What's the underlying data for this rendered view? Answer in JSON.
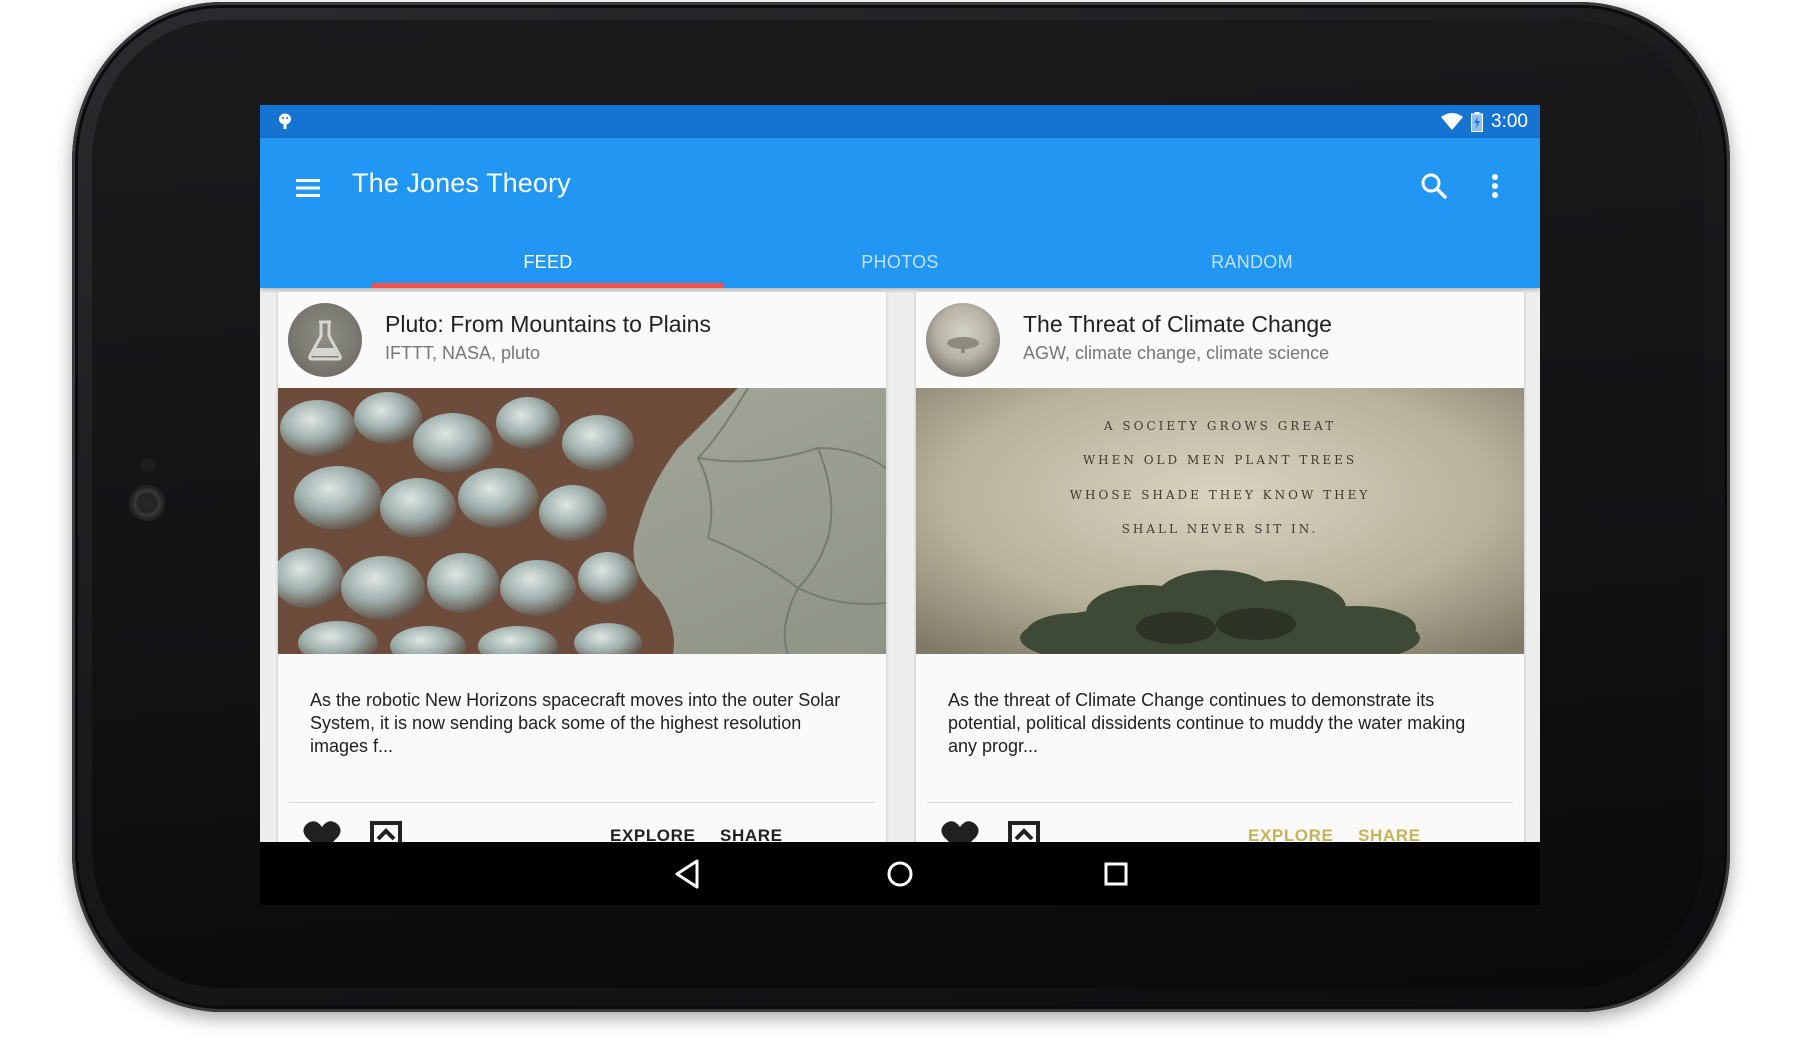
{
  "status_bar": {
    "time": "3:00",
    "notification_icon": "android-debug-icon",
    "wifi_icon": "wifi-icon",
    "battery_icon": "battery-charging-icon"
  },
  "app_bar": {
    "title": "The Jones Theory",
    "menu_icon": "menu-icon",
    "search_icon": "search-icon",
    "overflow_icon": "more-vert-icon",
    "color": "#2196f3"
  },
  "tabs": [
    {
      "label": "FEED",
      "active": true
    },
    {
      "label": "PHOTOS",
      "active": false
    },
    {
      "label": "RANDOM",
      "active": false
    }
  ],
  "tab_indicator_color": "#ef5350",
  "cards": [
    {
      "title": "Pluto: From Mountains to Plains",
      "tags": "IFTTT, NASA, pluto",
      "avatar_icon": "flask-icon",
      "body": "As the robotic New Horizons spacecraft moves into the outer Solar System, it is now sending back some of the highest resolution images f...",
      "actions": {
        "explore": "EXPLORE",
        "share": "SHARE"
      },
      "action_color": "#212121"
    },
    {
      "title": "The Threat of Climate Change",
      "tags": "AGW, climate change, climate science",
      "avatar_icon": "tree-icon",
      "image_quote": [
        "A SOCIETY GROWS GREAT",
        "WHEN OLD MEN PLANT TREES",
        "WHOSE SHADE THEY KNOW THEY",
        "SHALL NEVER SIT IN."
      ],
      "body": "As the threat of Climate Change continues to demonstrate its potential, political dissidents continue to muddy the water making any progr...",
      "actions": {
        "explore": "EXPLORE",
        "share": "SHARE"
      },
      "action_color": "#c5b358"
    }
  ],
  "nav_bar": {
    "back_icon": "back-icon",
    "home_icon": "home-icon",
    "recents_icon": "recents-icon"
  }
}
